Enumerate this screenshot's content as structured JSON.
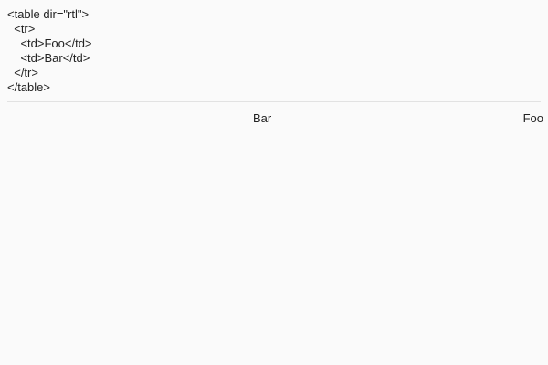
{
  "code": {
    "lines": [
      "<table dir=\"rtl\">",
      "  <tr>",
      "    <td>Foo</td>",
      "    <td>Bar</td>",
      "  </tr>",
      "</table>"
    ]
  },
  "table": {
    "dir": "rtl",
    "cells": [
      "Foo",
      "Bar"
    ]
  },
  "colors": {
    "background": "#fafafa",
    "text": "#222222",
    "divider": "#e2e2e2"
  }
}
